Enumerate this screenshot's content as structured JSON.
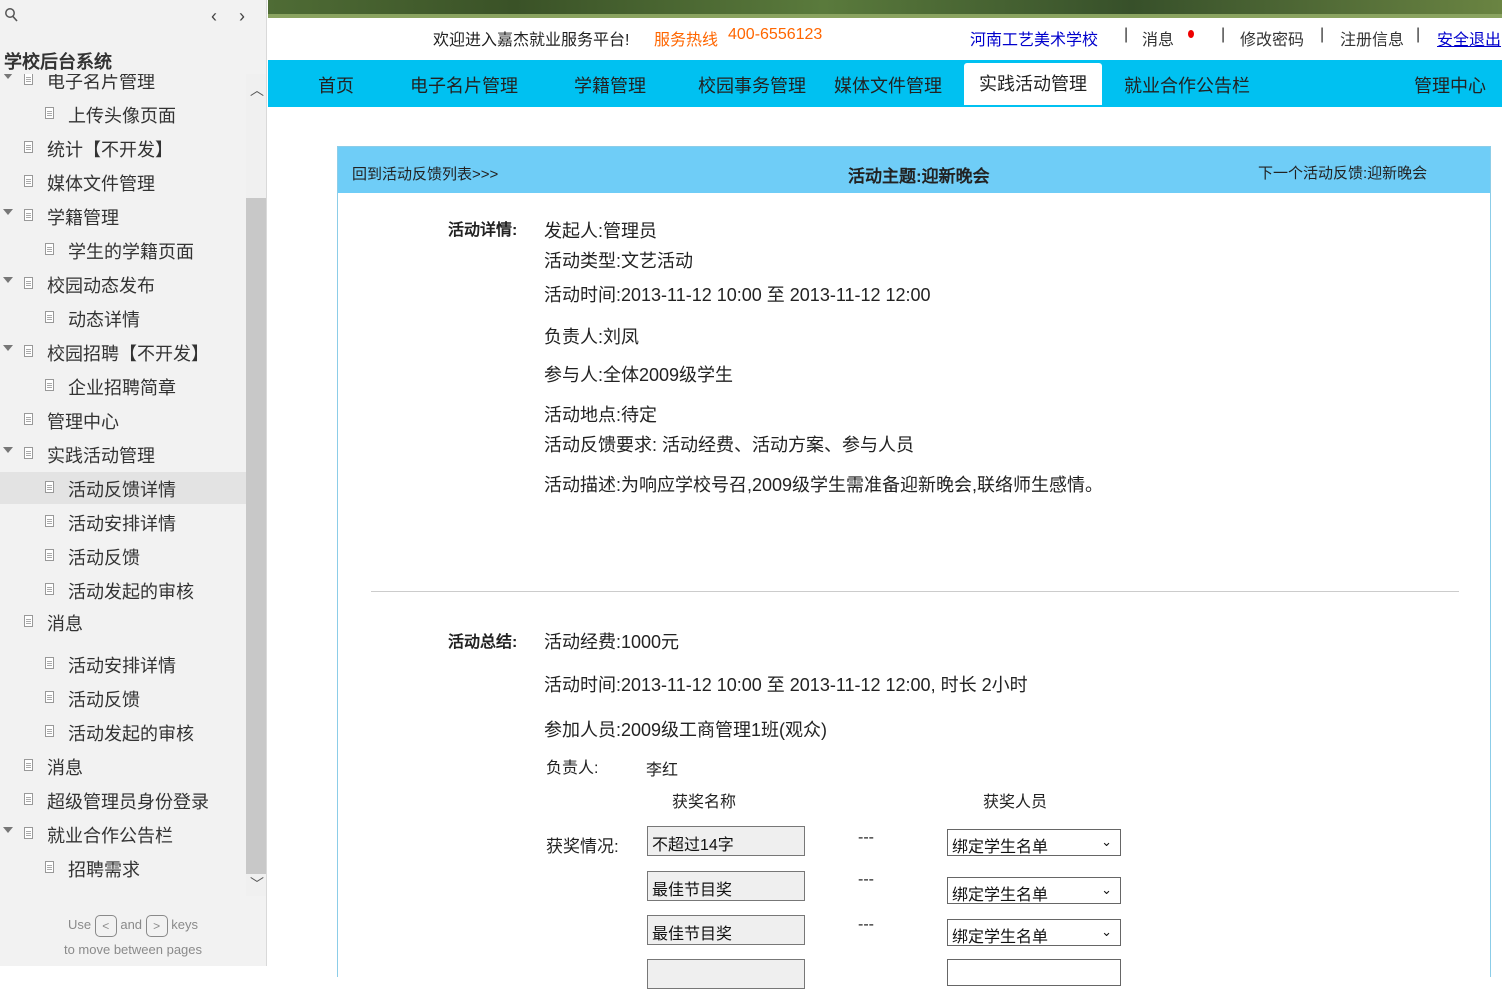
{
  "sidebar": {
    "title": "学校后台系统",
    "tree": [
      {
        "label": "电子名片管理",
        "level": 1,
        "expanded": true,
        "selected": false
      },
      {
        "label": "上传头像页面",
        "level": 2,
        "selected": false
      },
      {
        "label": "统计【不开发】",
        "level": 1,
        "selected": false
      },
      {
        "label": "媒体文件管理",
        "level": 1,
        "selected": false
      },
      {
        "label": "学籍管理",
        "level": 1,
        "expanded": true,
        "selected": false
      },
      {
        "label": "学生的学籍页面",
        "level": 2,
        "selected": false
      },
      {
        "label": "校园动态发布",
        "level": 1,
        "expanded": true,
        "selected": false
      },
      {
        "label": "动态详情",
        "level": 2,
        "selected": false
      },
      {
        "label": "校园招聘【不开发】",
        "level": 1,
        "expanded": true,
        "selected": false
      },
      {
        "label": "企业招聘简章",
        "level": 2,
        "selected": false
      },
      {
        "label": "管理中心",
        "level": 1,
        "selected": false
      },
      {
        "label": "实践活动管理",
        "level": 1,
        "expanded": true,
        "selected": false
      },
      {
        "label": "活动反馈详情",
        "level": 2,
        "selected": true
      },
      {
        "label": "活动安排详情",
        "level": 2,
        "selected": false
      },
      {
        "label": "活动反馈",
        "level": 2,
        "selected": false
      },
      {
        "label": "活动发起的审核",
        "level": 2,
        "selected": false
      },
      {
        "label": "消息",
        "level": 1,
        "selected": false
      },
      {
        "label": "活动安排详情",
        "level": 2,
        "selected": false
      },
      {
        "label": "活动反馈",
        "level": 2,
        "selected": false
      },
      {
        "label": "活动发起的审核",
        "level": 2,
        "selected": false
      },
      {
        "label": "消息",
        "level": 1,
        "selected": false
      },
      {
        "label": "超级管理员身份登录",
        "level": 1,
        "selected": false
      },
      {
        "label": "就业合作公告栏",
        "level": 1,
        "expanded": true,
        "selected": false
      },
      {
        "label": "招聘需求",
        "level": 2,
        "selected": false
      }
    ],
    "footer_use": "Use",
    "footer_and": "and",
    "footer_keys": "keys",
    "footer_line2": "to move between pages"
  },
  "topbar": {
    "welcome": "欢迎进入嘉杰就业服务平台!",
    "hotline_label": "服务热线",
    "hotline": "400-6556123",
    "school": "河南工艺美术学校",
    "messages": "消息",
    "change_password": "修改密码",
    "register_info": "注册信息",
    "logout": "安全退出",
    "separator": "|"
  },
  "nav": {
    "items": [
      "首页",
      "电子名片管理",
      "学籍管理",
      "校园事务管理",
      "媒体文件管理",
      "实践活动管理",
      "就业合作公告栏",
      "管理中心"
    ],
    "active": "实践活动管理"
  },
  "panel": {
    "back_link": "回到活动反馈列表>>>",
    "title": "活动主题:迎新晚会",
    "next_link": "下一个活动反馈:迎新晚会",
    "details_label": "活动详情:",
    "details": [
      "发起人:管理员",
      "活动类型:文艺活动",
      "活动时间:2013-11-12 10:00 至 2013-11-12 12:00",
      "负责人:刘凤",
      "参与人:全体2009级学生",
      "活动地点:待定",
      "活动反馈要求: 活动经费、活动方案、参与人员",
      "活动描述:为响应学校号召,2009级学生需准备迎新晚会,联络师生感情。"
    ],
    "summary_label": "活动总结:",
    "summary": [
      "活动经费:1000元",
      "活动时间:2013-11-12 10:00 至 2013-11-12 12:00, 时长 2小时",
      "参加人员:2009级工商管理1班(观众)"
    ],
    "leader_label": "负责人:",
    "leader": "李红",
    "award_name_header": "获奖名称",
    "award_person_header": "获奖人员",
    "award_label": "获奖情况:",
    "awards": [
      {
        "name": "不超过14字",
        "dash": "---",
        "select": "绑定学生名单"
      },
      {
        "name": "最佳节目奖",
        "dash": "---",
        "select": "绑定学生名单"
      },
      {
        "name": "最佳节目奖",
        "dash": "---",
        "select": "绑定学生名单"
      }
    ]
  }
}
